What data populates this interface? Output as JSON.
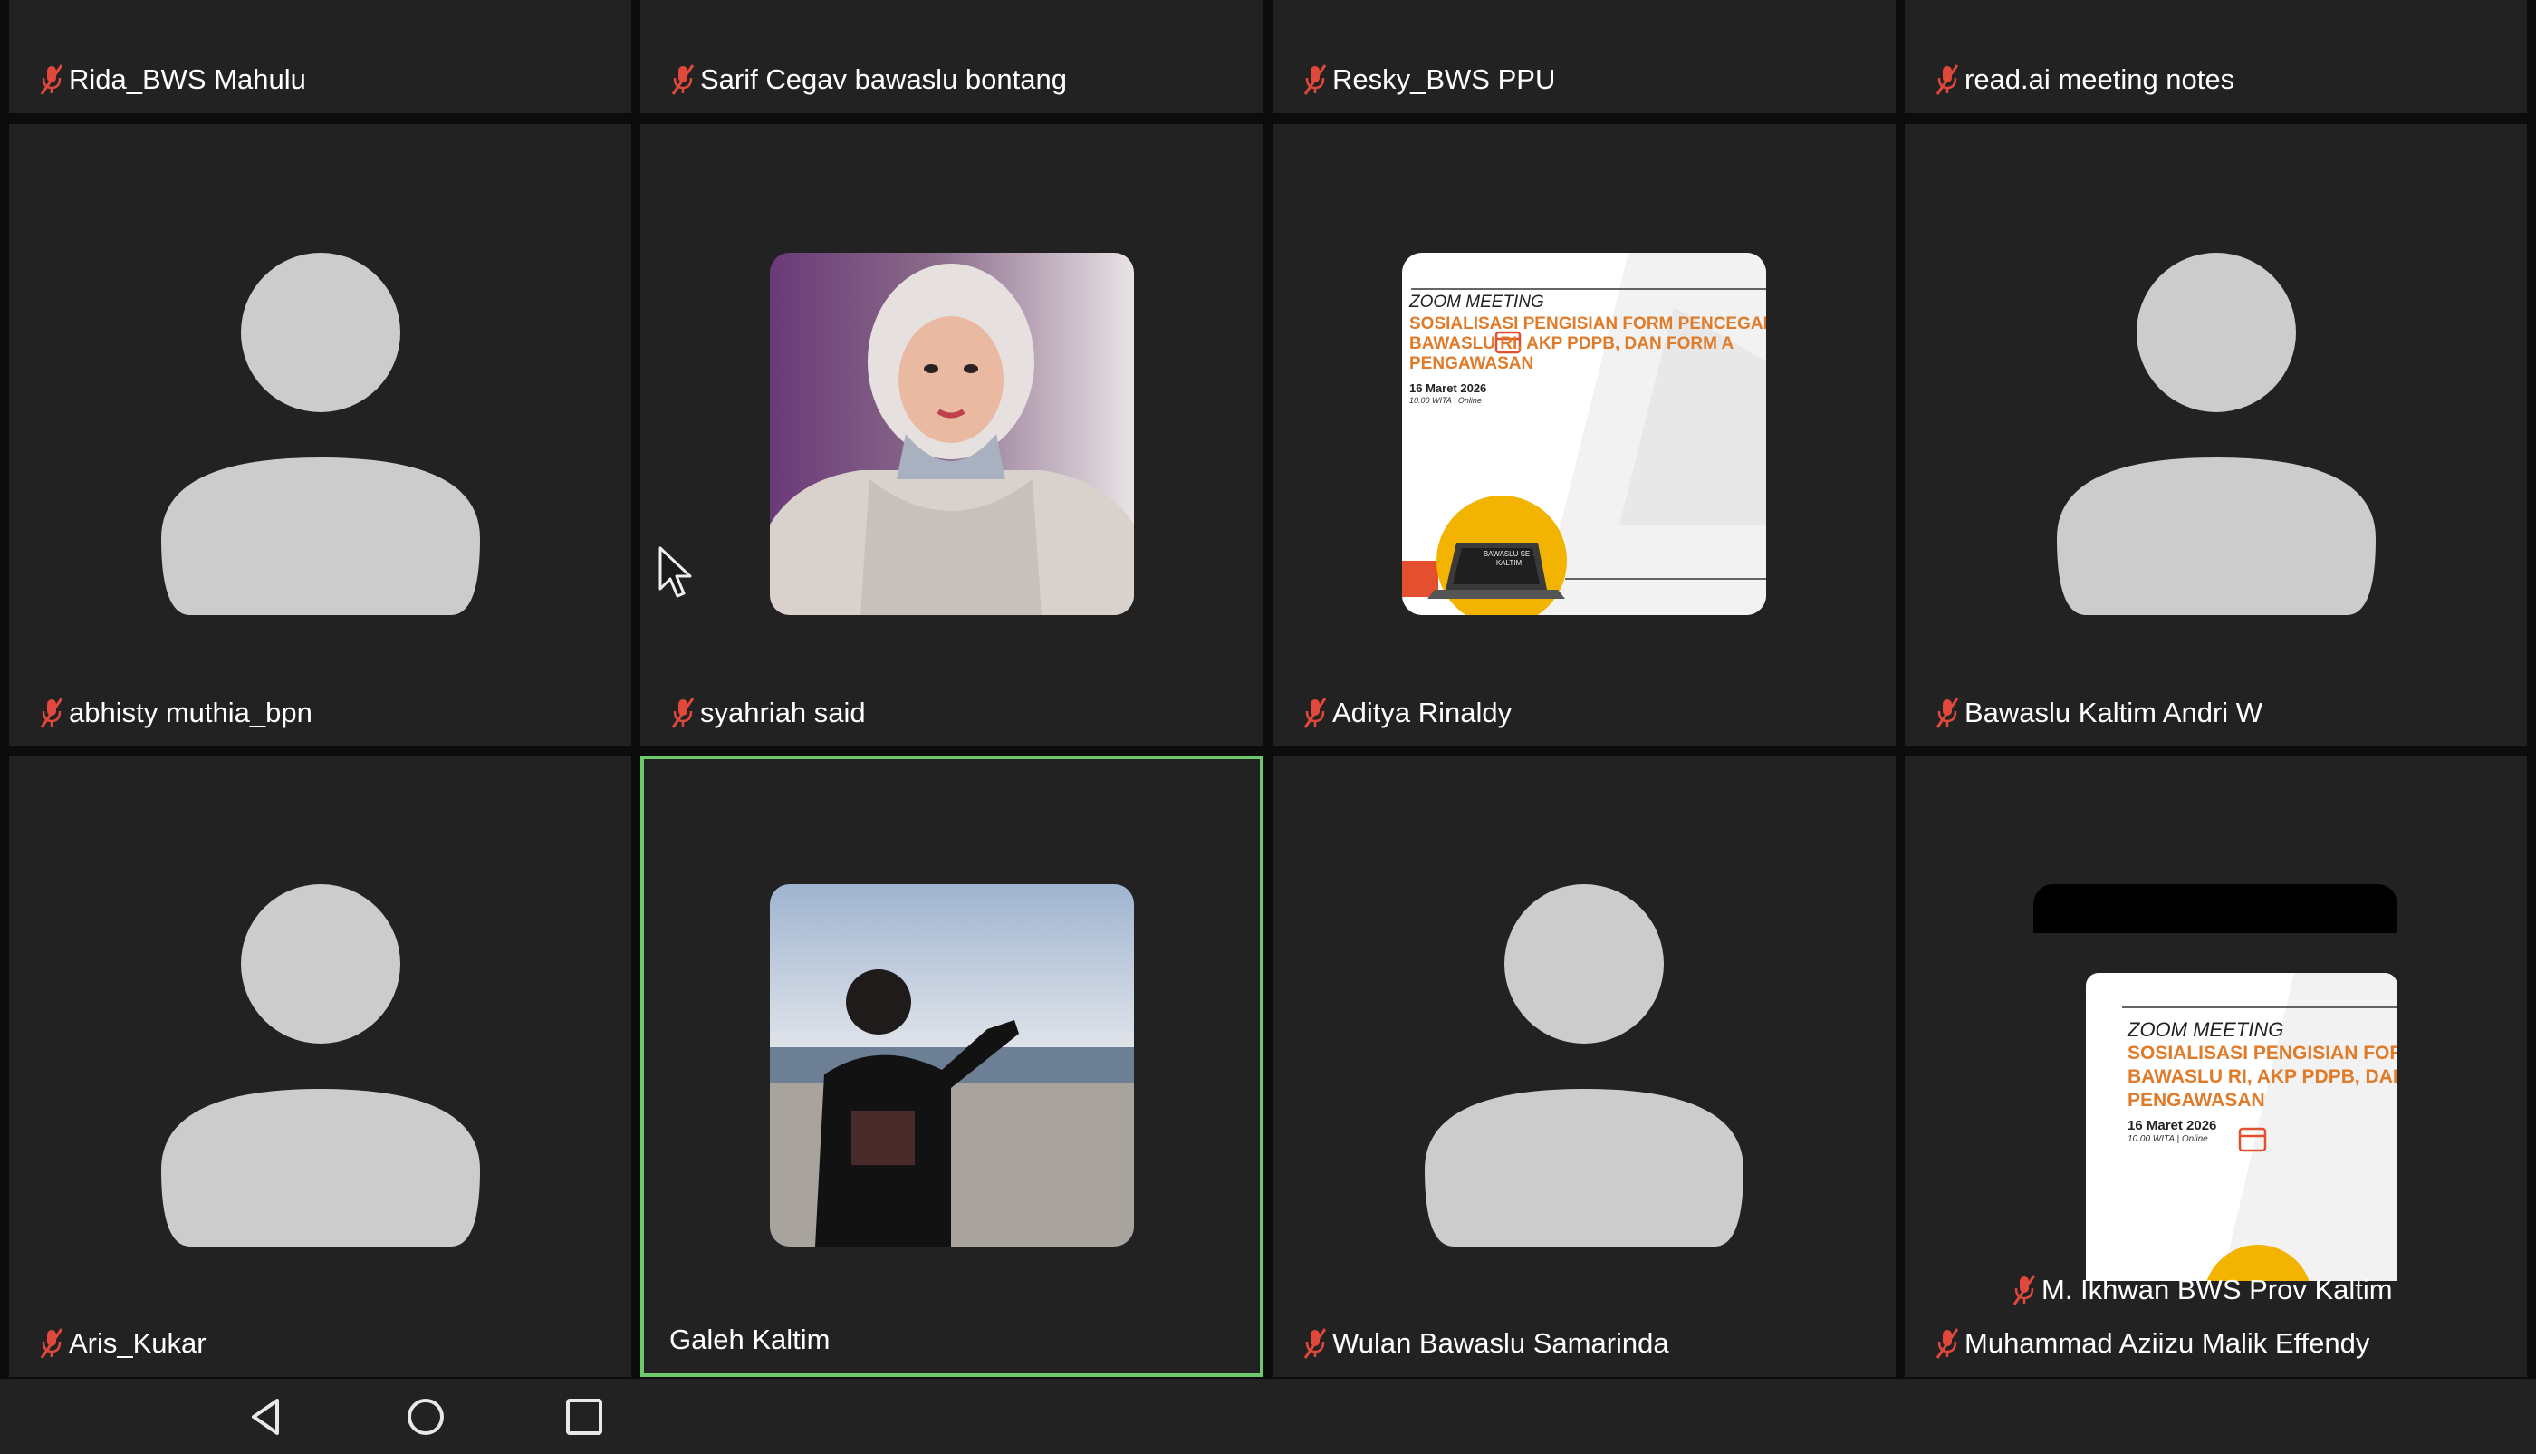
{
  "tiles": [
    {
      "name": "Rida_BWS Mahulu",
      "muted": true,
      "type": "name-only"
    },
    {
      "name": "Sarif Cegav bawaslu bontang",
      "muted": true,
      "type": "name-only"
    },
    {
      "name": "Resky_BWS PPU",
      "muted": true,
      "type": "name-only"
    },
    {
      "name": "read.ai meeting notes",
      "muted": true,
      "type": "name-only"
    },
    {
      "name": "abhisty muthia_bpn",
      "muted": true,
      "type": "avatar"
    },
    {
      "name": "syahriah said",
      "muted": true,
      "type": "video-portrait"
    },
    {
      "name": "Aditya Rinaldy",
      "muted": true,
      "type": "video-poster"
    },
    {
      "name": "Bawaslu Kaltim Andri W",
      "muted": true,
      "type": "avatar"
    },
    {
      "name": "Aris_Kukar",
      "muted": true,
      "type": "avatar"
    },
    {
      "name": "Galeh Kaltim",
      "muted": false,
      "type": "video-beach",
      "active": true
    },
    {
      "name": "Wulan Bawaslu Samarinda",
      "muted": true,
      "type": "avatar"
    },
    {
      "name": "Muhammad Aziizu Malik Effendy",
      "muted": true,
      "type": "shared-poster"
    }
  ],
  "poster": {
    "label": "ZOOM MEETING",
    "title_l1": "SOSIALISASI PENGISIAN FORM PENCEGAHAN",
    "title_l2": "BAWASLU RI, AKP PDPB, DAN FORM A",
    "title_l3": "PENGAWASAN",
    "date": "16 Maret 2026",
    "time": "10.00 WITA | Online",
    "laptop_text": "BAWASLU SE - KALTIM"
  },
  "poster2": {
    "label": "ZOOM MEETING",
    "title_l1": "SOSIALISASI PENGISIAN FORM",
    "title_l2": "BAWASLU RI, AKP PDPB, DAN",
    "title_l3": "PENGAWASAN",
    "date": "16 Maret 2026",
    "time": "10.00 WITA | Online"
  },
  "overlay_name": "M. Ikhwan BWS Prov Kaltim",
  "colors": {
    "tile": "#222222",
    "active_border": "#6cc96c",
    "mute": "#e0483c",
    "avatar": "#cccccc"
  },
  "icons": [
    "muted-mic-icon",
    "back-icon",
    "home-icon",
    "recents-icon",
    "cursor-icon"
  ]
}
